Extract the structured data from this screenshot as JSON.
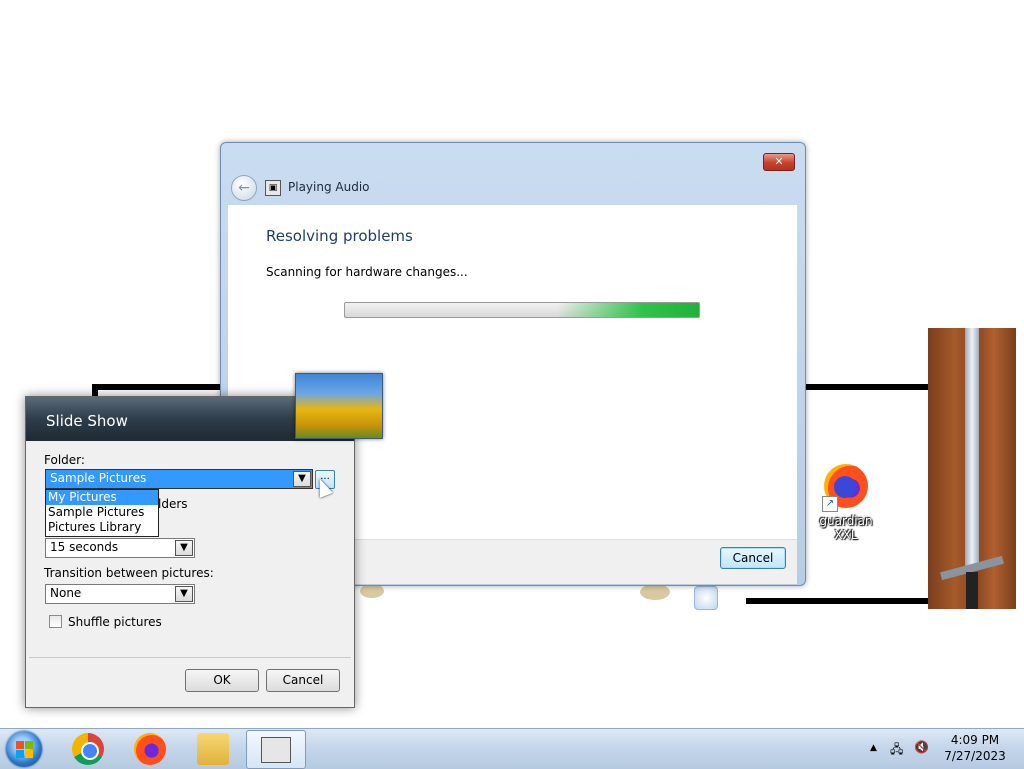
{
  "desktop": {
    "icon_label": "guardian XXL"
  },
  "troubleshooter": {
    "title": "Playing Audio",
    "heading": "Resolving problems",
    "status": "Scanning for hardware changes...",
    "progress_fraction": 0.4,
    "close_icon": "close-x",
    "back_icon": "back-arrow",
    "cancel_label": "Cancel"
  },
  "slideshow": {
    "title": "Slide Show",
    "folder_label": "Folder:",
    "folder_selected": "Sample Pictures",
    "browse_label": "...",
    "folder_options": [
      "My Pictures",
      "Sample Pictures",
      "Pictures Library"
    ],
    "subfolders_fragment": "lders",
    "interval_value": "15 seconds",
    "transition_label": "Transition between pictures:",
    "transition_value": "None",
    "shuffle_label": "Shuffle pictures",
    "ok_label": "OK",
    "cancel_label": "Cancel"
  },
  "taskbar": {
    "time": "4:09 PM",
    "date": "7/27/2023",
    "tray_arrow": "▲"
  },
  "colors": {
    "selection": "#3399ff",
    "progress_green": "#2fc24a",
    "dialog_header": "#2d3d4a"
  }
}
